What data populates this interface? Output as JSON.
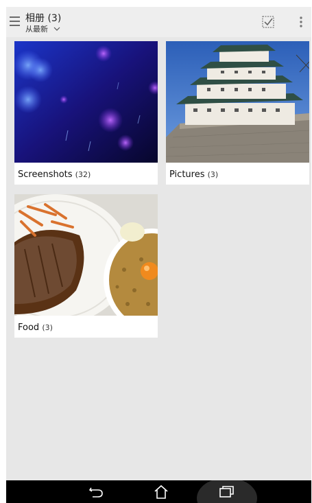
{
  "header": {
    "title": "相册 (3)",
    "sort_label": "从最新"
  },
  "albums": [
    {
      "name": "Screenshots",
      "count": "(32)"
    },
    {
      "name": "Pictures",
      "count": "(3)"
    },
    {
      "name": "Food",
      "count": "(3)"
    }
  ],
  "icons": {
    "menu": "hamburger-menu-icon",
    "sort": "chevron-down-icon",
    "select": "select-all-icon",
    "overflow": "more-options-icon",
    "back": "back-icon",
    "home": "home-icon",
    "recents": "recent-apps-icon"
  },
  "colors": {
    "background": "#e7e7e7",
    "actionbar": "#eeeeee",
    "navbar": "#000000"
  }
}
